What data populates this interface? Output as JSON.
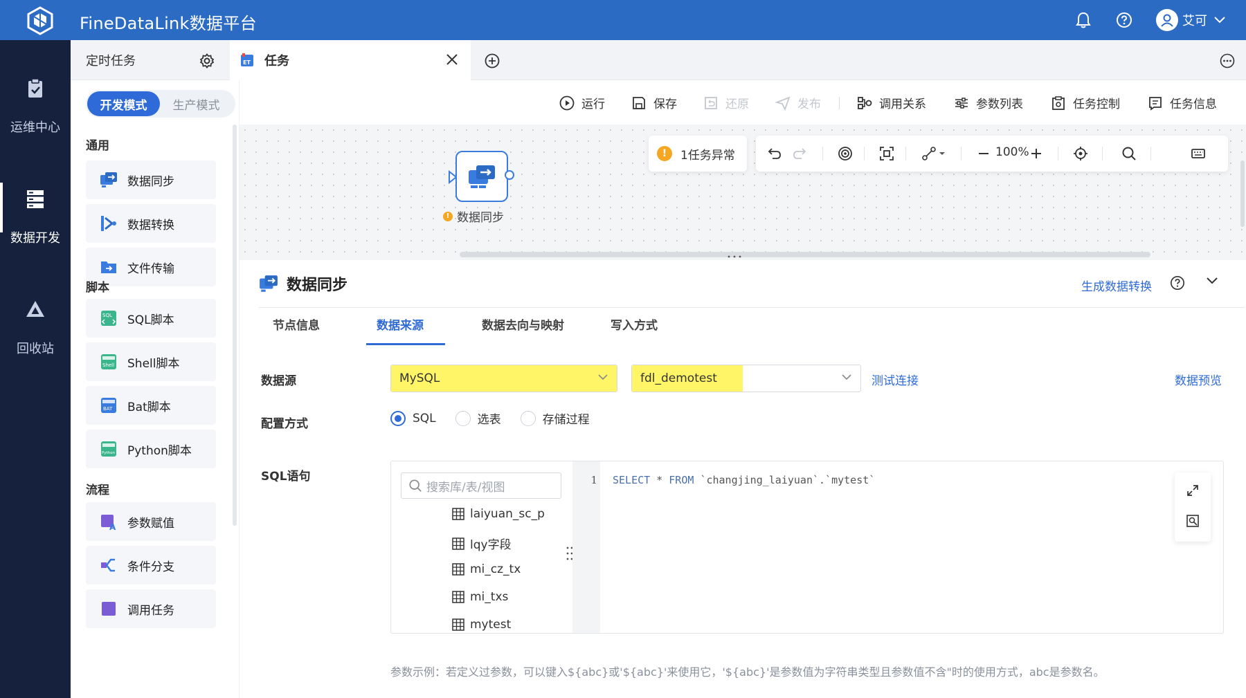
{
  "app": {
    "title": "FineDataLink数据平台",
    "user_name": "艾可"
  },
  "leftnav": {
    "items": [
      {
        "label": "运维中心",
        "icon": "clipboard-check-icon"
      },
      {
        "label": "数据开发",
        "icon": "server-icon",
        "active": true
      },
      {
        "label": "回收站",
        "icon": "recycle-icon"
      }
    ]
  },
  "tabs": {
    "scheduled": "定时任务",
    "task": "任务"
  },
  "modes": {
    "dev": "开发模式",
    "prod": "生产模式"
  },
  "components": {
    "general_title": "通用",
    "general": [
      "数据同步",
      "数据转换",
      "文件传输"
    ],
    "script_title": "脚本",
    "script": [
      "SQL脚本",
      "Shell脚本",
      "Bat脚本",
      "Python脚本"
    ],
    "flow_title": "流程",
    "flow": [
      "参数赋值",
      "条件分支",
      "调用任务"
    ]
  },
  "icon_badges": {
    "sql": "SQL",
    "shell": "Shell",
    "bat": "BAT",
    "python": "Python"
  },
  "toolbar": {
    "run": "运行",
    "save": "保存",
    "restore": "还原",
    "publish": "发布",
    "call_relation": "调用关系",
    "param_list": "参数列表",
    "task_control": "任务控制",
    "task_info": "任务信息"
  },
  "canvas": {
    "node_label": "数据同步",
    "abnormal": "1任务异常",
    "zoom": "100%",
    "warn_mark": "!"
  },
  "detail": {
    "title": "数据同步",
    "generate_link": "生成数据转换",
    "tabs": [
      "节点信息",
      "数据来源",
      "数据去向与映射",
      "写入方式"
    ],
    "active_tab": "数据来源",
    "datasource_label": "数据源",
    "datasource_type": "MySQL",
    "datasource_conn": "fdl_demotest",
    "test_connection": "测试连接",
    "preview": "数据预览",
    "config_label": "配置方式",
    "config_options": [
      "SQL",
      "选表",
      "存储过程"
    ],
    "config_selected": "SQL",
    "sql_label": "SQL语句",
    "search_placeholder": "搜索库/表/视图",
    "tables": [
      "laiyuan_sc_p",
      "lqy字段",
      "mi_cz_tx",
      "mi_txs",
      "mytest"
    ],
    "line_number": "1",
    "sql_keywords": [
      "SELECT",
      "FROM"
    ],
    "sql_star": "*",
    "sql_target": "`changjing_laiyuan`.`mytest`",
    "hint": "参数示例：若定义过参数，可以键入${abc}或'${abc}'来使用它，'${abc}'是参数值为字符串类型且参数值不含\"时的使用方式，abc是参数名。"
  },
  "colors": {
    "topbar": "#2b6bc4",
    "leftnav": "#16213e",
    "accent": "#2f6bd8",
    "warning": "#f5a623",
    "highlight": "#fff566"
  }
}
